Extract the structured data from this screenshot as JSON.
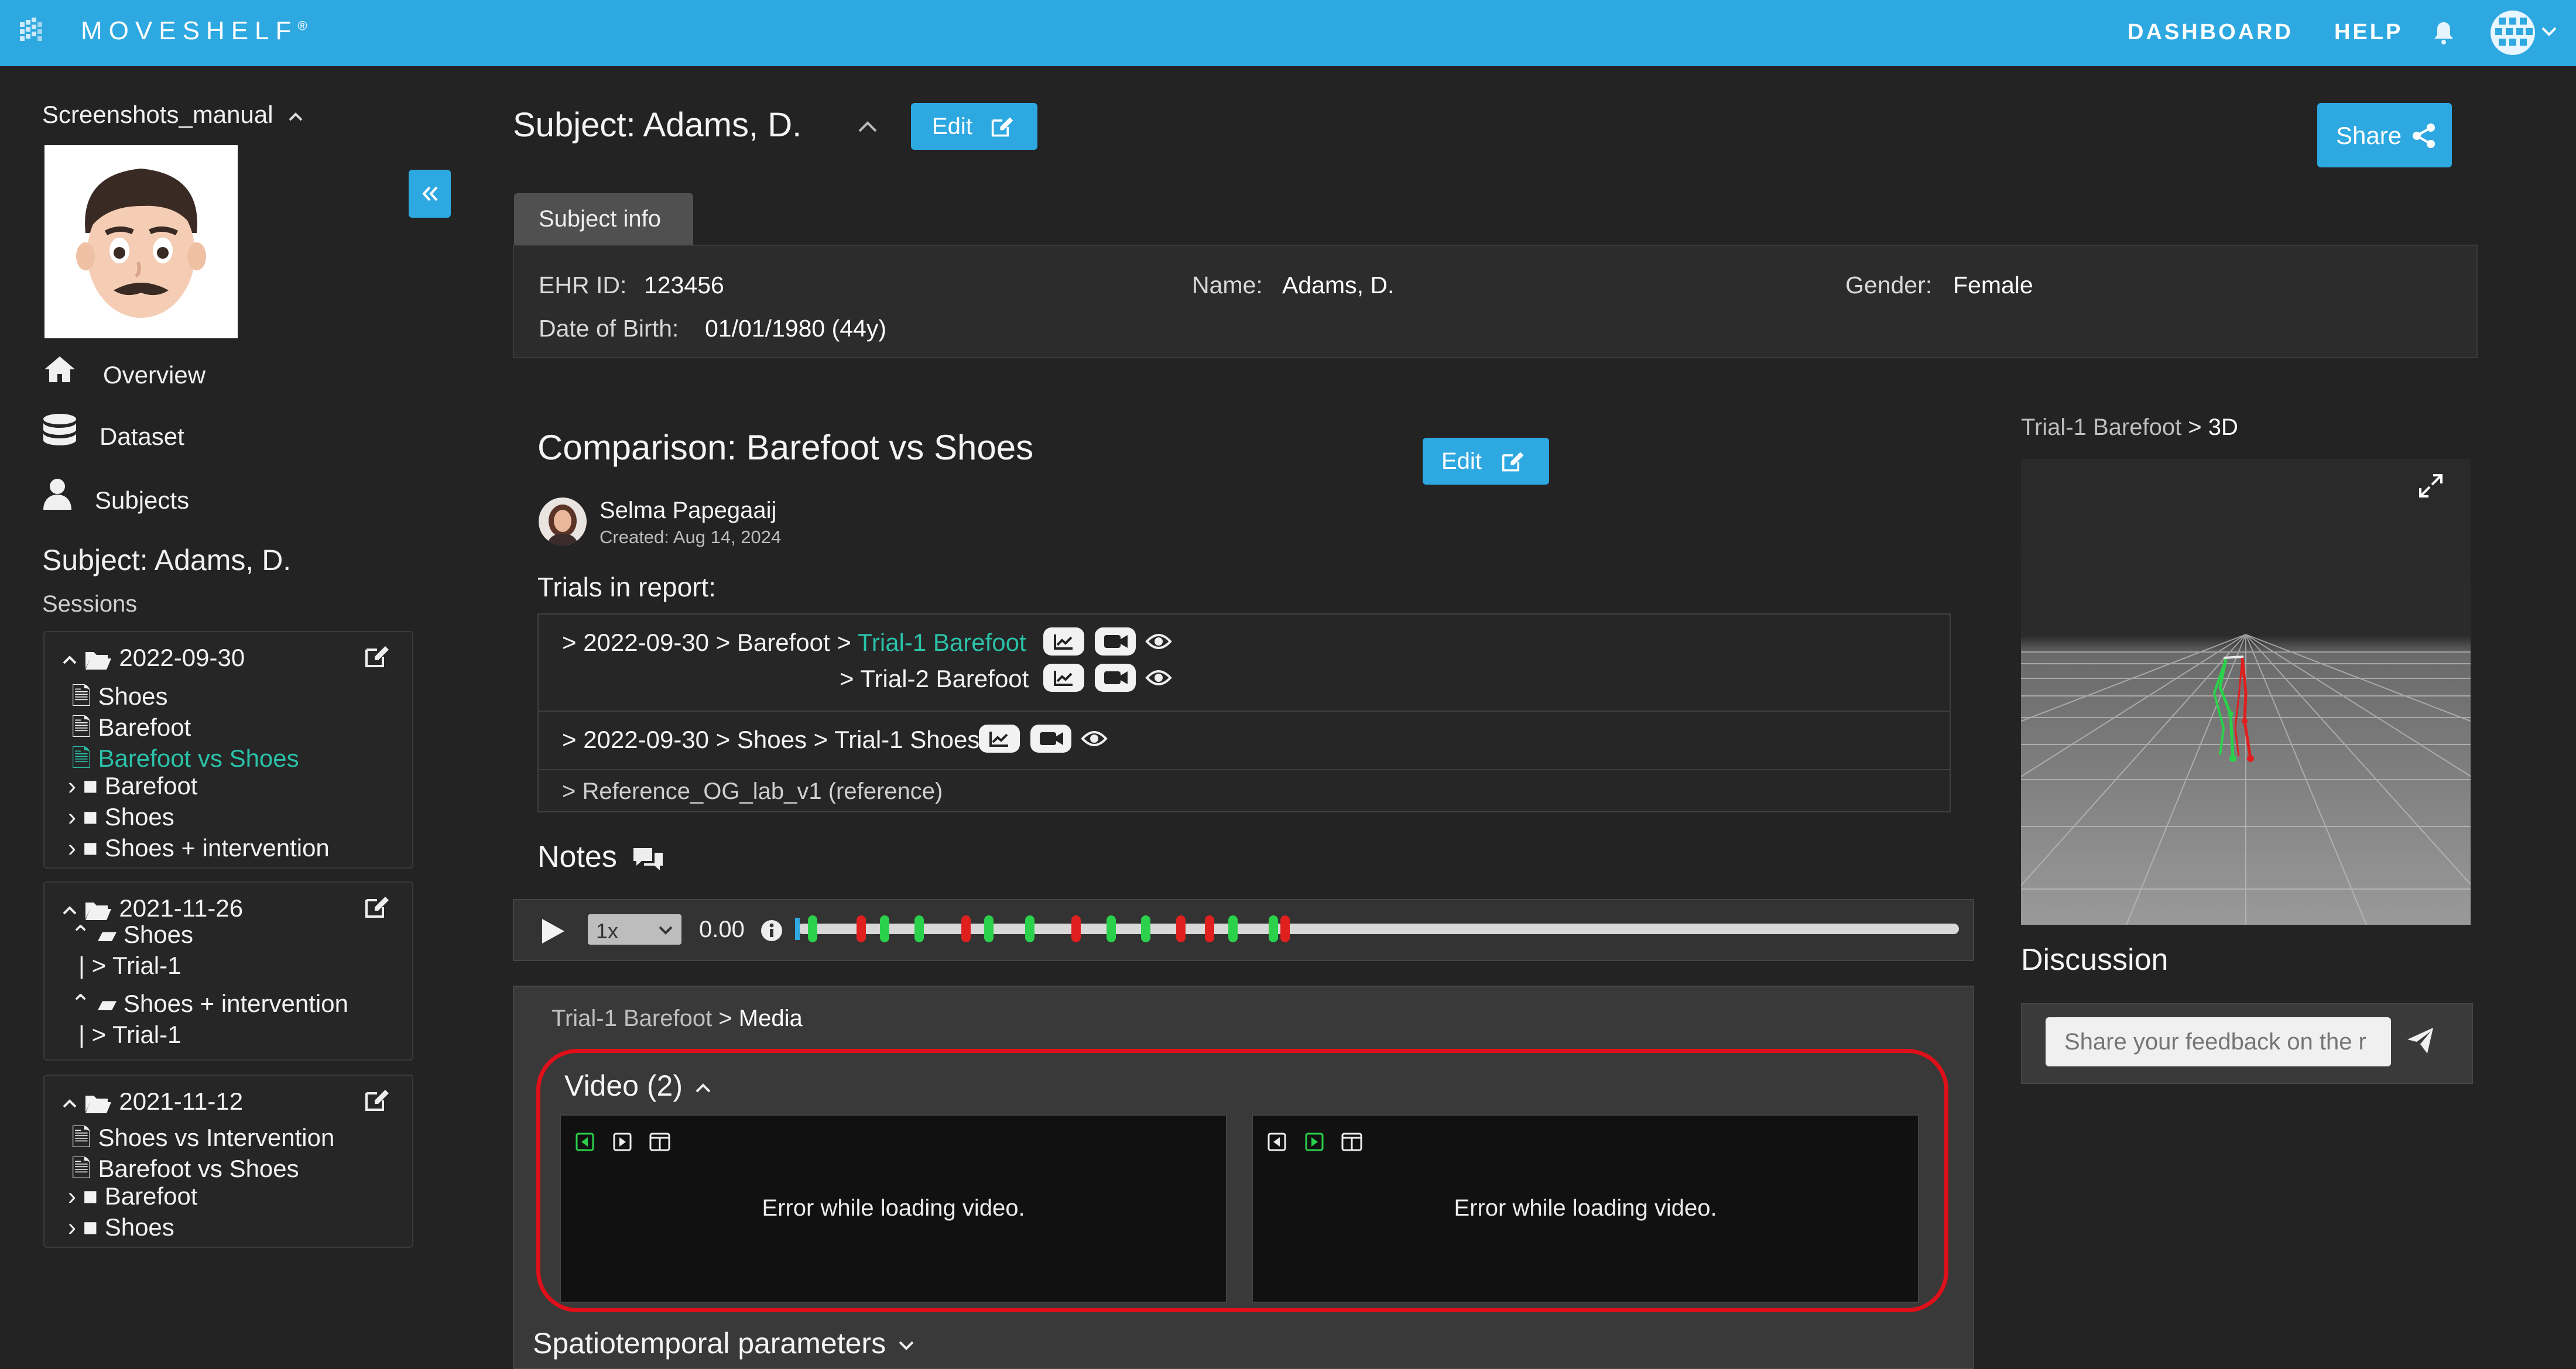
{
  "app": {
    "brand": "MOVESHELF",
    "reg": "®"
  },
  "nav": {
    "dashboard": "DASHBOARD",
    "help": "HELP"
  },
  "sidebar": {
    "project": "Screenshots_manual",
    "menu": [
      {
        "label": "Overview",
        "icon": "home-icon"
      },
      {
        "label": "Dataset",
        "icon": "database-icon"
      },
      {
        "label": "Subjects",
        "icon": "user-icon"
      }
    ],
    "subject_heading": "Subject: Adams, D.",
    "sessions_label": "Sessions",
    "sessions": [
      {
        "date": "2022-09-30",
        "items": [
          "Shoes",
          "Barefoot",
          "Barefoot vs Shoes"
        ],
        "folders": [
          "Barefoot",
          "Shoes",
          "Shoes + intervention"
        ]
      },
      {
        "date": "2021-11-26",
        "sub": [
          {
            "folder": "Shoes",
            "trial": "> Trial-1"
          },
          {
            "folder": "Shoes + intervention",
            "trial": "> Trial-1"
          }
        ]
      },
      {
        "date": "2021-11-12",
        "items": [
          "Shoes vs Intervention",
          "Barefoot vs Shoes"
        ],
        "folders": [
          "Barefoot",
          "Shoes"
        ]
      }
    ]
  },
  "subject": {
    "title": "Subject: Adams, D.",
    "edit_label": "Edit",
    "share_label": "Share",
    "tab": "Subject info",
    "ehr_label": "EHR ID:",
    "ehr_value": "123456",
    "name_label": "Name:",
    "name_value": "Adams, D.",
    "gender_label": "Gender:",
    "gender_value": "Female",
    "dob_label": "Date of Birth:",
    "dob_value": "01/01/1980 (44y)"
  },
  "comparison": {
    "title": "Comparison: Barefoot vs Shoes",
    "edit_label": "Edit",
    "author": "Selma Papegaaij",
    "created": "Created: Aug 14, 2024",
    "trials_heading": "Trials in report:",
    "row1_prefix": "> 2022-09-30 > Barefoot > ",
    "row1_link": "Trial-1 Barefoot",
    "row2": "> Trial-2 Barefoot",
    "row3": "> 2022-09-30 > Shoes > Trial-1 Shoes",
    "row4": "> Reference_OG_lab_v1 (reference)",
    "notes": "Notes"
  },
  "player": {
    "speed": "1x",
    "speed_options": [
      "1x"
    ],
    "time": "0.00",
    "progress": 0.0,
    "markers": [
      {
        "pos": 0.013,
        "color": "#2bd14a"
      },
      {
        "pos": 0.055,
        "color": "#e0201e"
      },
      {
        "pos": 0.075,
        "color": "#2bd14a"
      },
      {
        "pos": 0.105,
        "color": "#2bd14a"
      },
      {
        "pos": 0.145,
        "color": "#e0201e"
      },
      {
        "pos": 0.165,
        "color": "#2bd14a"
      },
      {
        "pos": 0.2,
        "color": "#2bd14a"
      },
      {
        "pos": 0.24,
        "color": "#e0201e"
      },
      {
        "pos": 0.27,
        "color": "#2bd14a"
      },
      {
        "pos": 0.3,
        "color": "#2bd14a"
      },
      {
        "pos": 0.33,
        "color": "#e0201e"
      },
      {
        "pos": 0.355,
        "color": "#e0201e"
      },
      {
        "pos": 0.375,
        "color": "#2bd14a"
      },
      {
        "pos": 0.41,
        "color": "#2bd14a"
      },
      {
        "pos": 0.42,
        "color": "#e0201e"
      }
    ]
  },
  "media": {
    "crumb_trial": "Trial-1 Barefoot",
    "crumb_sep": " > ",
    "crumb_page": "Media",
    "video_heading": "Video (2)",
    "error_text": "Error while loading video.",
    "spatiotemporal": "Spatiotemporal parameters"
  },
  "viewer": {
    "crumb_trial": "Trial-1 Barefoot",
    "crumb_sep": " > ",
    "crumb_page": "3D"
  },
  "discussion": {
    "heading": "Discussion",
    "placeholder": "Share your feedback on the r"
  },
  "colors": {
    "accent": "#2ea8e0",
    "teal": "#2bc1a8",
    "highlight": "#e0101a"
  }
}
